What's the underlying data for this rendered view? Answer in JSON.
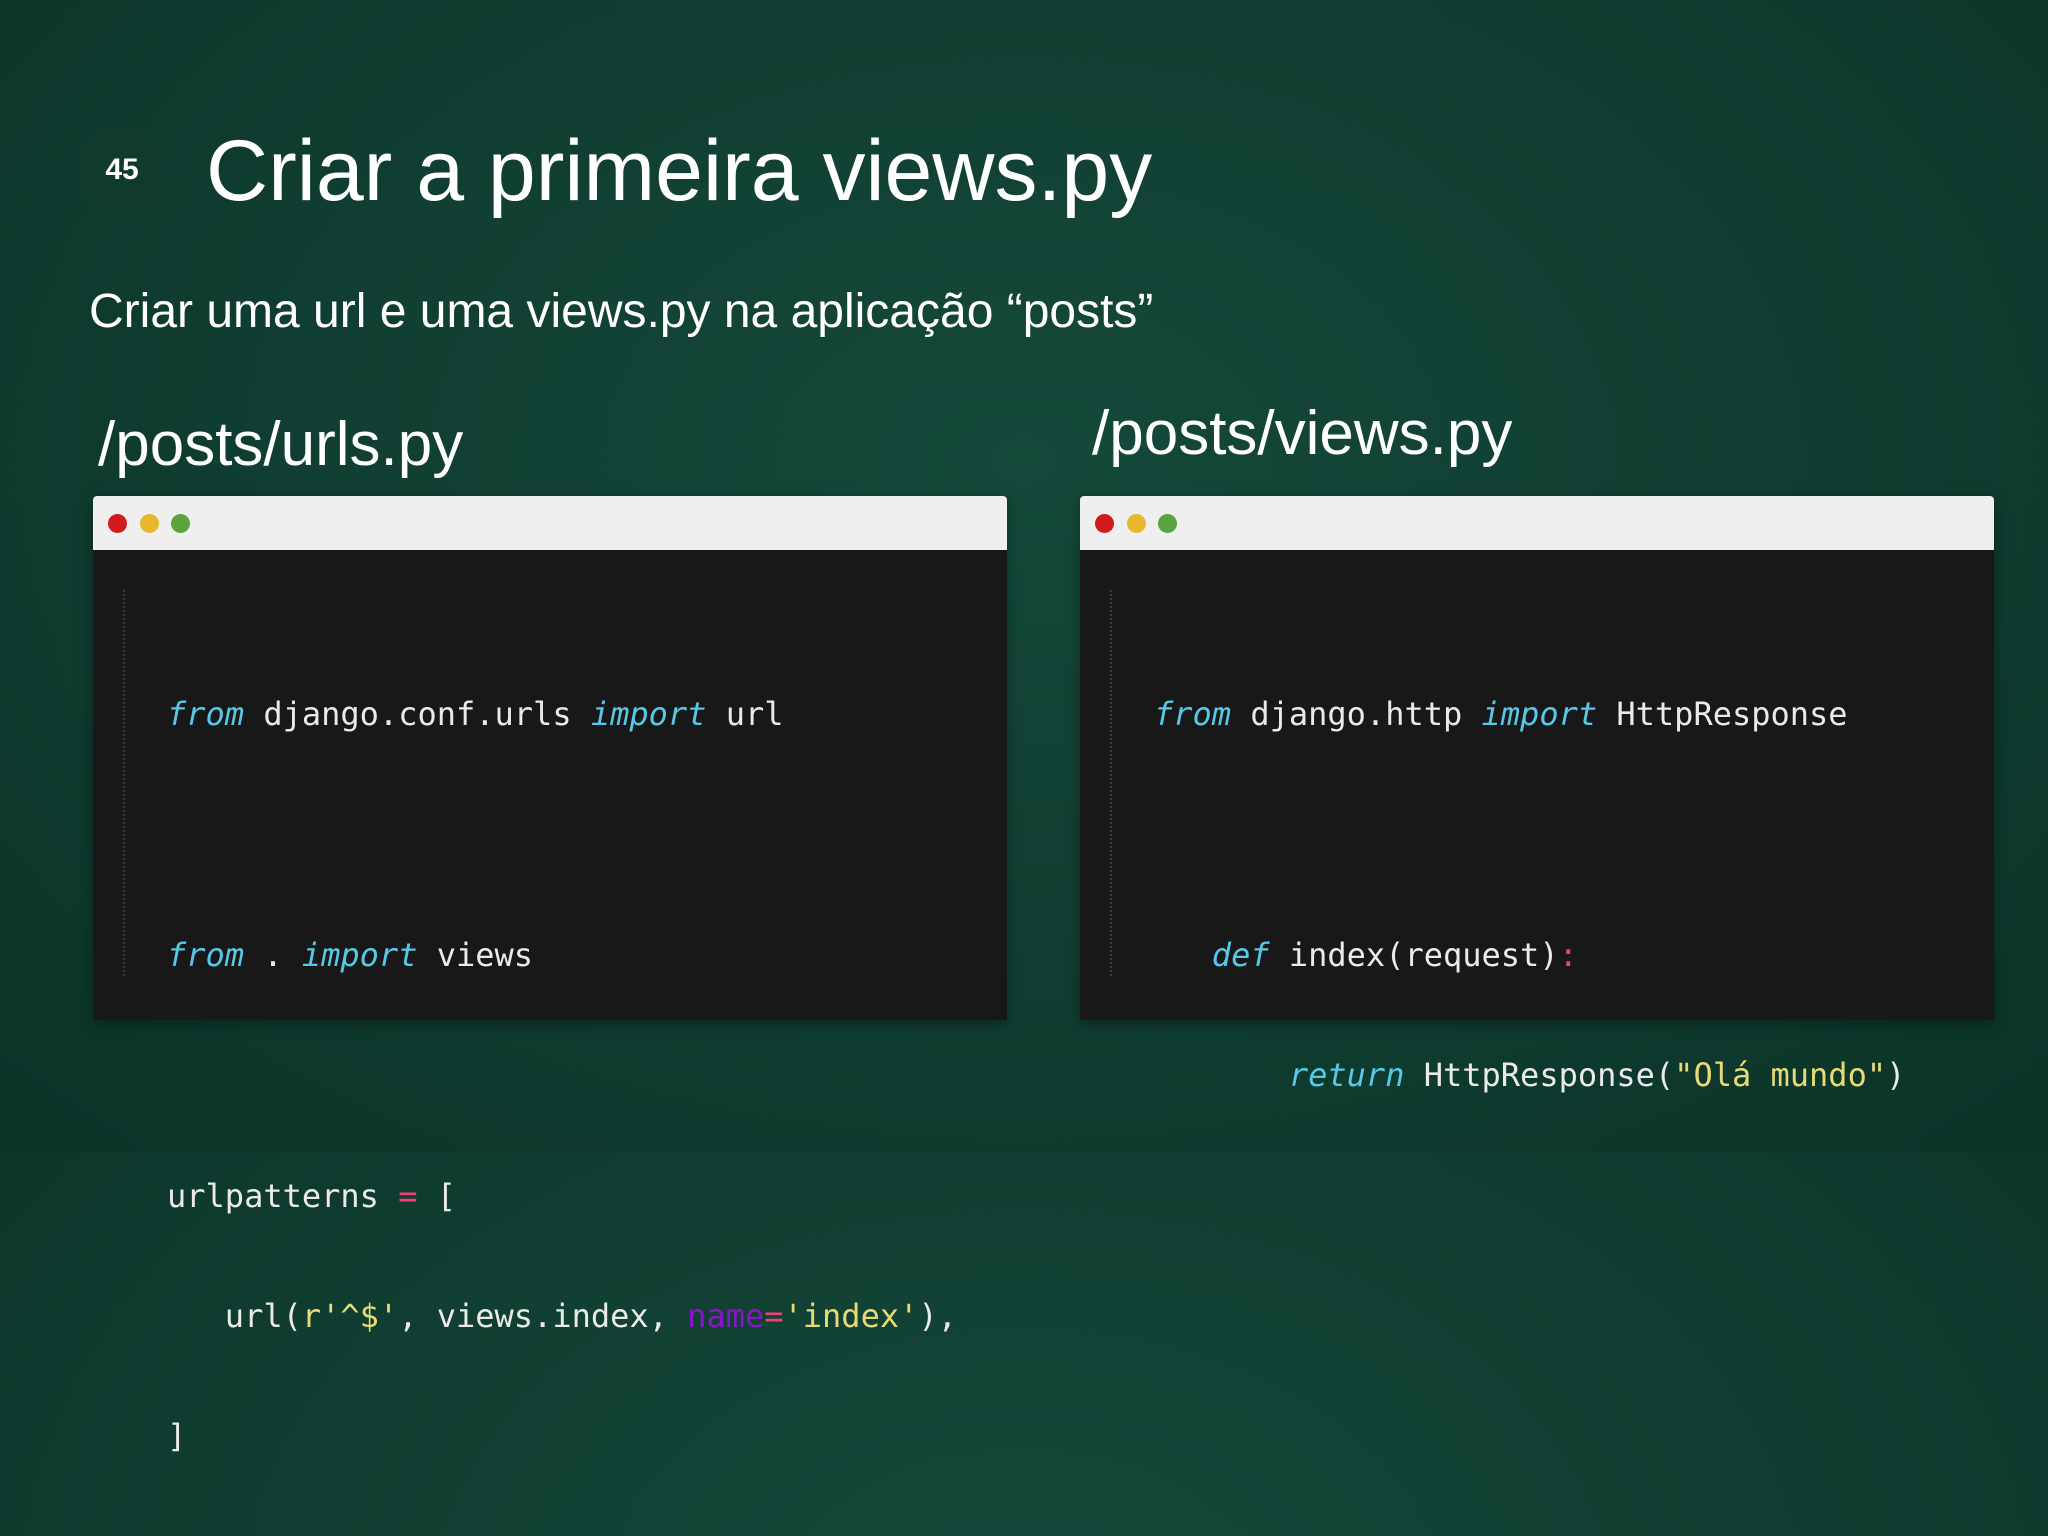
{
  "slide": {
    "number": "45",
    "title": "Criar a primeira views.py",
    "subtitle": "Criar uma url e uma views.py na aplicação “posts”"
  },
  "panels": [
    {
      "heading": "/posts/urls.py",
      "code": {
        "l1_kw1": "from",
        "l1_t1": " django.conf.urls ",
        "l1_kw2": "import",
        "l1_t2": " url",
        "l2_kw1": "from",
        "l2_t1": " . ",
        "l2_kw2": "import",
        "l2_t2": " views",
        "l3_t1": "urlpatterns ",
        "l3_op": "=",
        "l3_t2": " [",
        "l4_t1": "   url(",
        "l4_str1": "r'^$'",
        "l4_t2": ", views.index, ",
        "l4_param": "name",
        "l4_op": "=",
        "l4_str2": "'index'",
        "l4_t3": "),",
        "l5_t1": "]"
      }
    },
    {
      "heading": "/posts/views.py",
      "code": {
        "l1_kw1": "from",
        "l1_t1": " django.http ",
        "l1_kw2": "import",
        "l1_t2": " HttpResponse",
        "l2_t0": "   ",
        "l2_kw1": "def",
        "l2_t1": " index(request)",
        "l2_op": ":",
        "l3_t0": "       ",
        "l3_kw1": "return",
        "l3_t1": " HttpResponse(",
        "l3_str": "\"Olá mundo\"",
        "l3_t2": ")"
      }
    }
  ],
  "colors": {
    "background": "#103d31",
    "badge": "#0f3a2d",
    "editor_bg": "#181818",
    "titlebar": "#efefef",
    "keyword": "#55c9e6",
    "string": "#e6db74",
    "operator": "#f0407a",
    "parameter": "#8b14c9"
  }
}
